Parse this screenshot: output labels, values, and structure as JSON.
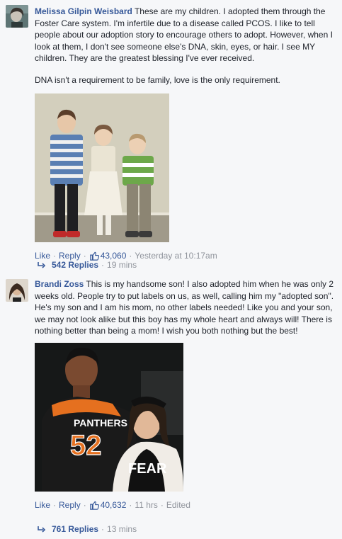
{
  "comments": [
    {
      "author": "Melissa Gilpin Weisbard",
      "text": " These are my children. I adopted them through the Foster Care system. I'm infertile due to a disease called PCOS. I like to tell people about our adoption story to encourage others to adopt. However, when I look at them, I don't see someone else's DNA, skin, eyes, or hair. I see MY children. They are the greatest blessing I've ever received.",
      "text2": "DNA isn't a requirement to be family, love is the only requirement.",
      "like_label": "Like",
      "reply_label": "Reply",
      "like_count": "43,060",
      "timestamp": "Yesterday at 10:17am",
      "edited": "",
      "replies_label": "542 Replies",
      "replies_time": "19 mins",
      "photo_alt": "Three children standing together"
    },
    {
      "author": "Brandi Zoss",
      "text": " This is my handsome son! I also adopted him when he was only 2 weeks old. People try to put labels on us, as well, calling him my \"adopted son\". He's my son and I am his mom, no other labels needed! Like you and your son, we may not look alike but this boy has my whole heart and always will! There is nothing better than being a mom! I wish you both nothing but the best!",
      "like_label": "Like",
      "reply_label": "Reply",
      "like_count": "40,632",
      "timestamp": "11 hrs",
      "edited": "Edited",
      "replies_label": "761 Replies",
      "replies_time": "13 mins",
      "jersey_text": "PANTHERS",
      "jersey_number": "52",
      "shirt_text": "FEAR"
    }
  ],
  "colors": {
    "link": "#365899",
    "meta": "#90949c",
    "background": "#f6f7f9",
    "text": "#1d2129"
  },
  "icons": {
    "like": "thumbs-up-icon",
    "reply_arrow": "reply-arrow-icon"
  }
}
